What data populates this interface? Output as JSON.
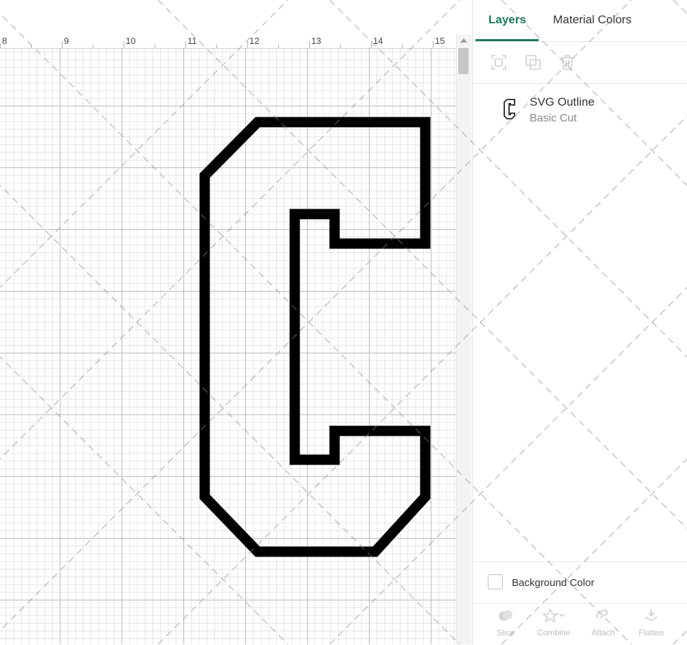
{
  "ruler": {
    "labels": [
      "8",
      "9",
      "10",
      "11",
      "12",
      "13",
      "14",
      "15"
    ]
  },
  "canvas": {
    "shape_icon": "letter-c-outline-shape",
    "stroke_color": "#000000"
  },
  "panel": {
    "tabs": {
      "layers": "Layers",
      "material_colors": "Material Colors"
    },
    "accent_color": "#1c7a55",
    "layer_tools": [
      "group-icon",
      "duplicate-icon",
      "delete-icon"
    ],
    "layer": {
      "name": "SVG Outline",
      "operation": "Basic Cut",
      "thumbnail_icon": "letter-c-thumbnail-icon"
    },
    "background_color_label": "Background Color",
    "bottom_tools": {
      "slice": "Slice",
      "combine": "Combine",
      "attach": "Attach",
      "flatten": "Flatten"
    }
  }
}
